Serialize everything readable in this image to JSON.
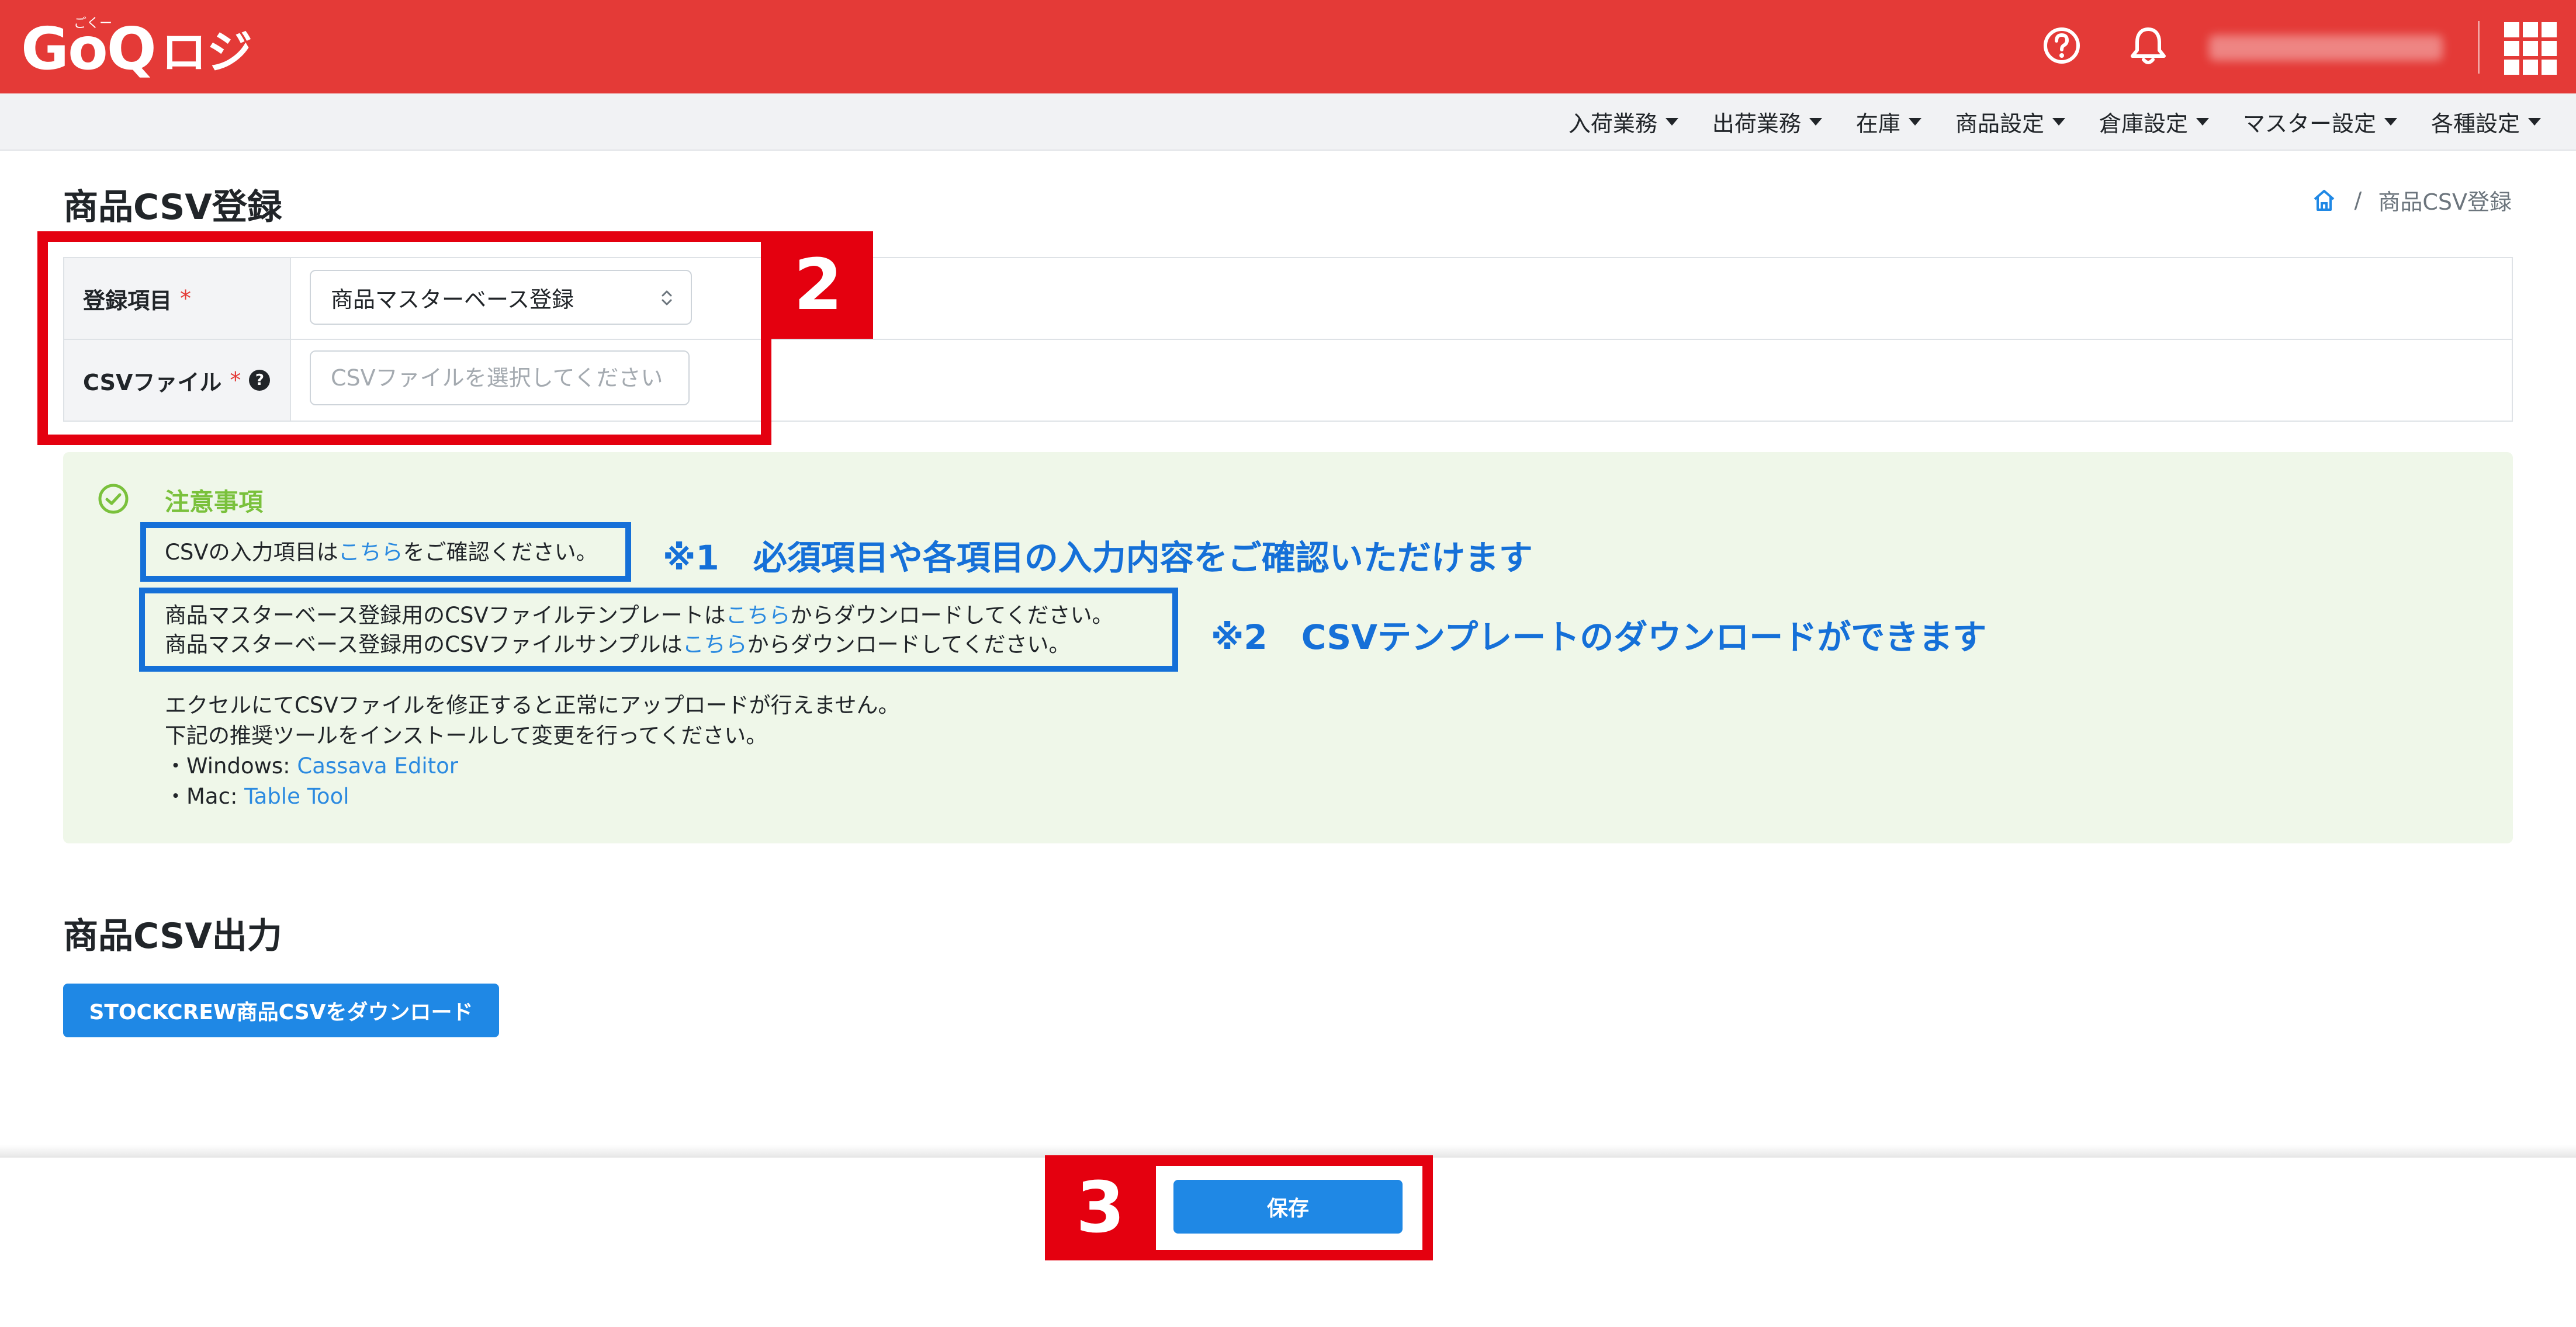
{
  "header": {
    "logo_main": "GoQ",
    "logo_sub": "ロジ",
    "logo_kana": "ごくー",
    "icons": [
      "help-circle-icon",
      "bell-icon",
      "apps-grid-icon"
    ],
    "bg_color": "#e43a37"
  },
  "nav": {
    "items": [
      {
        "label": "入荷業務"
      },
      {
        "label": "出荷業務"
      },
      {
        "label": "在庫"
      },
      {
        "label": "商品設定"
      },
      {
        "label": "倉庫設定"
      },
      {
        "label": "マスター設定"
      },
      {
        "label": "各種設定"
      }
    ]
  },
  "page": {
    "title": "商品CSV登録"
  },
  "breadcrumb": {
    "home_icon": "home-icon",
    "separator": "/",
    "current": "商品CSV登録"
  },
  "form": {
    "register_label": "登録項目",
    "required_mark": "*",
    "register_value": "商品マスターベース登録",
    "csv_label": "CSVファイル",
    "csv_help": "?",
    "csv_placeholder": "CSVファイルを選択してください"
  },
  "notice": {
    "title": "注意事項",
    "line1_pre": "CSVの入力項目は",
    "line1_link": "こちら",
    "line1_post": "をご確認ください。",
    "line2_pre": "商品マスターベース登録用のCSVファイルテンプレートは",
    "line2_link": "こちら",
    "line2_post": "からダウンロードしてください。",
    "line3_pre": "商品マスターベース登録用のCSVファイルサンプルは",
    "line3_link": "こちら",
    "line3_post": "からダウンロードしてください。",
    "line4": "エクセルにてCSVファイルを修正すると正常にアップロードが行えません。",
    "line5": "下記の推奨ツールをインストールして変更を行ってください。",
    "line6_pre": "・Windows: ",
    "line6_link": "Cassava Editor",
    "line7_pre": "・Mac: ",
    "line7_link": "Table Tool"
  },
  "annotations": {
    "step2": "2",
    "step3": "3",
    "note1": "※1　必須項目や各項目の入力内容をご確認いただけます",
    "note2": "※2　CSVテンプレートのダウンロードができます"
  },
  "export": {
    "title": "商品CSV出力",
    "button_label": "STOCKCREW商品CSVをダウンロード"
  },
  "footer": {
    "save_label": "保存"
  },
  "colors": {
    "accent": "#1f88e5",
    "brand": "#e43a37",
    "notice_bg": "#eff7e9",
    "notice_title": "#7ac13c",
    "annotation_red": "#e4000f",
    "annotation_blue": "#1570d8"
  }
}
